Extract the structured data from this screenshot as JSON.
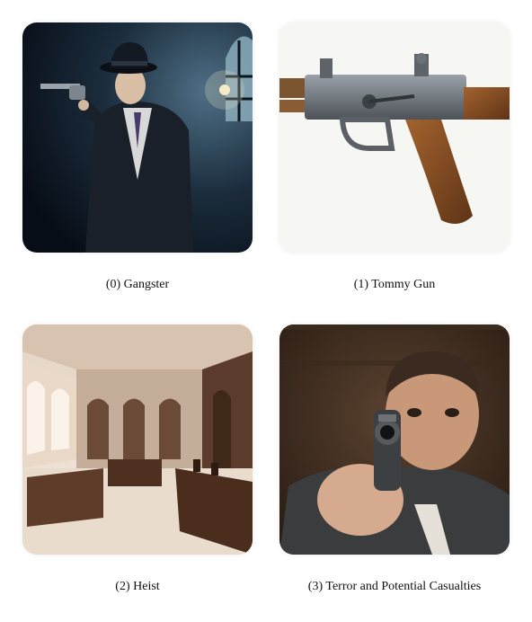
{
  "panels": [
    {
      "caption": "(0) Gangster"
    },
    {
      "caption": "(1) Tommy Gun"
    },
    {
      "caption": "(2) Heist"
    },
    {
      "caption": "(3) Terror and Potential Casualties"
    }
  ],
  "colors": {
    "background": "#ffffff",
    "caption_text": "#111111"
  }
}
